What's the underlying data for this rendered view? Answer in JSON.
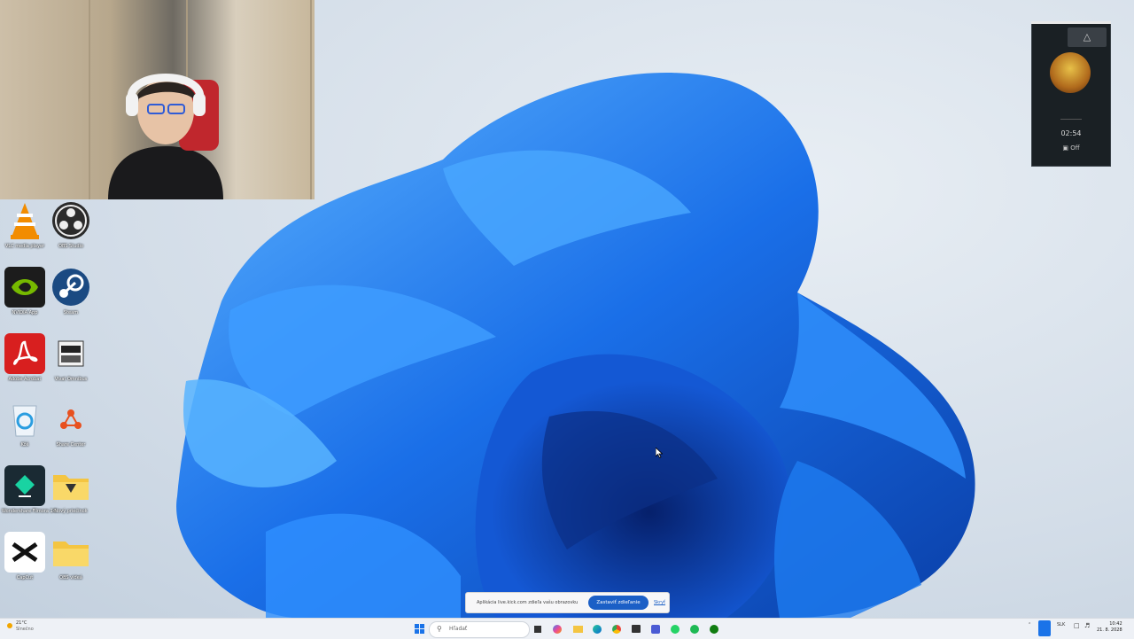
{
  "desktop": {
    "icons": [
      {
        "label": "VLC media player",
        "icon": "vlc-icon",
        "color": "#f28c00"
      },
      {
        "label": "OBS Studio",
        "icon": "obs-icon",
        "color": "#2b2b2b"
      },
      {
        "label": "NVIDIA App",
        "icon": "nvidia-icon",
        "color": "#76b900"
      },
      {
        "label": "Steam",
        "icon": "steam-icon",
        "color": "#1b2838"
      },
      {
        "label": "Adobe Acrobat",
        "icon": "acrobat-icon",
        "color": "#d81f1f"
      },
      {
        "label": "Vivat Omnibus",
        "icon": "vivat-icon",
        "color": "#e6e6e6"
      },
      {
        "label": "Kôš",
        "icon": "recycle-bin-icon",
        "color": "#2a9de0"
      },
      {
        "label": "Share Center",
        "icon": "share-icon",
        "color": "#e8501e"
      },
      {
        "label": "Wondershare Filmora 14",
        "icon": "filmora-icon",
        "color": "#1a1a2e"
      },
      {
        "label": "Nový priečinok",
        "icon": "folder-icon",
        "color": "#f4c542"
      },
      {
        "label": "CapCut",
        "icon": "capcut-icon",
        "color": "#111111"
      },
      {
        "label": "OBS videá",
        "icon": "folder-icon",
        "color": "#f4c542"
      }
    ]
  },
  "overlay": {
    "time": "02:54",
    "status": "Off"
  },
  "toast": {
    "message": "Aplikácia live.kick.com zdieľa vašu obrazovku",
    "share_button": "Zastaviť zdieľanie",
    "hide_link": "Skryť"
  },
  "taskbar": {
    "weather_temp": "21°C",
    "weather_desc": "Slnečno",
    "search_placeholder": "Hľadať",
    "language": "SLK",
    "clock_time": "10:42",
    "clock_date": "21. 8. 2028",
    "apps": [
      "start-icon",
      "task-view-icon",
      "copilot-icon",
      "file-explorer-icon",
      "edge-icon",
      "chrome-icon",
      "store-icon",
      "terminal-icon",
      "whatsapp-icon",
      "spotify-icon",
      "xbox-icon"
    ]
  }
}
